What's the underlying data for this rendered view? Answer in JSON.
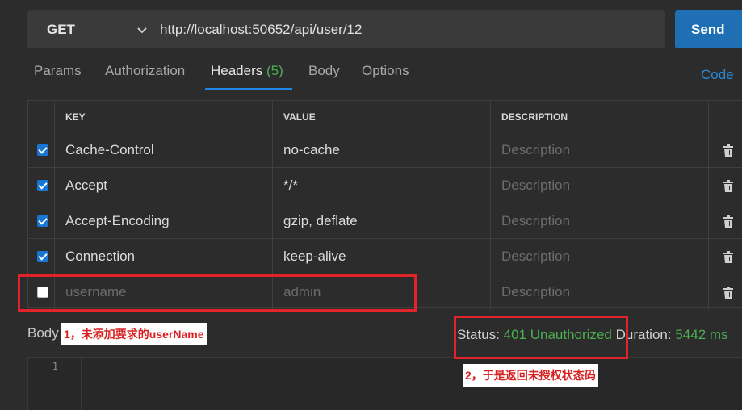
{
  "request": {
    "method": "GET",
    "url": "http://localhost:50652/api/user/12",
    "send_label": "Send"
  },
  "tabs": [
    {
      "label": "Params"
    },
    {
      "label": "Authorization"
    },
    {
      "label": "Headers",
      "count": "(5)"
    },
    {
      "label": "Body"
    },
    {
      "label": "Options"
    }
  ],
  "active_tab": "Headers",
  "code_link": "Code",
  "headers_table": {
    "columns": [
      "KEY",
      "VALUE",
      "DESCRIPTION"
    ],
    "rows": [
      {
        "key": "Cache-Control",
        "value": "no-cache",
        "description": "Description",
        "checked": true
      },
      {
        "key": "Accept",
        "value": "*/*",
        "description": "Description",
        "checked": true
      },
      {
        "key": "Accept-Encoding",
        "value": "gzip, deflate",
        "description": "Description",
        "checked": true
      },
      {
        "key": "Connection",
        "value": "keep-alive",
        "description": "Description",
        "checked": true
      },
      {
        "key": "username",
        "value": "admin",
        "description": "Description",
        "checked": false
      }
    ]
  },
  "response": {
    "body_label": "Body",
    "status_label": "Status:",
    "status_value": "401 Unauthorized",
    "duration_label": "Duration:",
    "duration_value": "5442 ms",
    "line_number": "1"
  },
  "annotations": {
    "note1": "1，未添加要求的userName",
    "note2": "2，于是返回未授权状态码"
  },
  "colors": {
    "background": "#2c2c2c",
    "send_button": "#1e6fb3",
    "accent_green": "#4caf50",
    "annotation_red": "#e0242a"
  }
}
